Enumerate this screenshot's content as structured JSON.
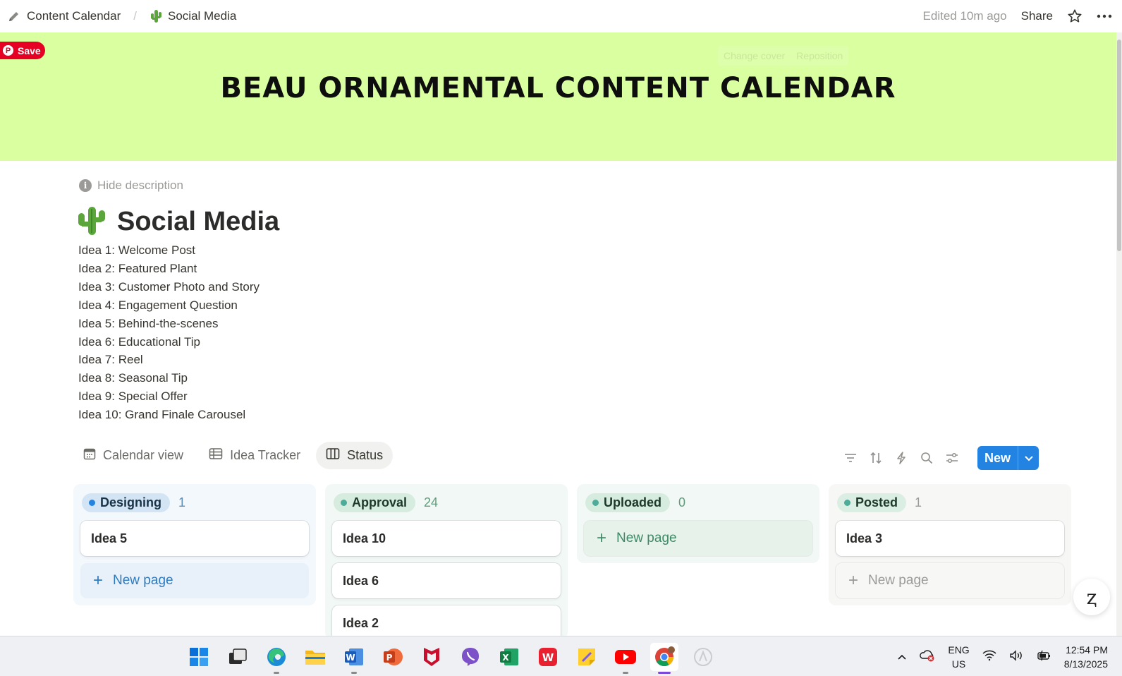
{
  "topbar": {
    "breadcrumb_1": "Content Calendar",
    "breadcrumb_sep": "/",
    "breadcrumb_2": "Social Media",
    "edited": "Edited 10m ago",
    "share": "Share"
  },
  "cover": {
    "title": "BEAU ORNAMENTAL CONTENT CALENDAR",
    "change_cover": "Change cover",
    "reposition": "Reposition",
    "color": "#d9ffa0",
    "pin_save": "Save"
  },
  "page": {
    "hide_description": "Hide description",
    "title": "Social Media",
    "description": [
      "Idea 1: Welcome Post",
      "Idea 2: Featured Plant",
      "Idea 3: Customer Photo and Story",
      "Idea 4: Engagement Question",
      "Idea 5: Behind-the-scenes",
      "Idea 6: Educational Tip",
      "Idea 7: Reel",
      "Idea 8: Seasonal Tip",
      "Idea 9: Special Offer",
      "Idea 10: Grand Finale Carousel"
    ]
  },
  "views": {
    "tabs": [
      "Calendar view",
      "Idea Tracker",
      "Status"
    ],
    "active": "Status",
    "new_button": "New"
  },
  "board": {
    "columns": [
      {
        "name": "Designing",
        "count": "1",
        "cards": [
          "Idea 5"
        ],
        "new_page": "New page",
        "color": "#2383e2"
      },
      {
        "name": "Approval",
        "count": "24",
        "cards": [
          "Idea 10",
          "Idea 6",
          "Idea 2"
        ],
        "color": "#4dab9a"
      },
      {
        "name": "Uploaded",
        "count": "0",
        "cards": [],
        "new_page": "New page",
        "color": "#4dab9a"
      },
      {
        "name": "Posted",
        "count": "1",
        "cards": [
          "Idea 3"
        ],
        "new_page": "New page",
        "color": "#4dab9a"
      }
    ]
  },
  "taskbar": {
    "apps": [
      "windows-start",
      "task-view",
      "edge",
      "file-explorer",
      "word",
      "powerpoint",
      "mcafee",
      "viber",
      "excel",
      "wps-office",
      "sticky-notes",
      "youtube",
      "chrome",
      "copilot"
    ],
    "lang_1": "ENG",
    "lang_2": "US",
    "time": "12:54 PM",
    "date": "8/13/2025"
  }
}
